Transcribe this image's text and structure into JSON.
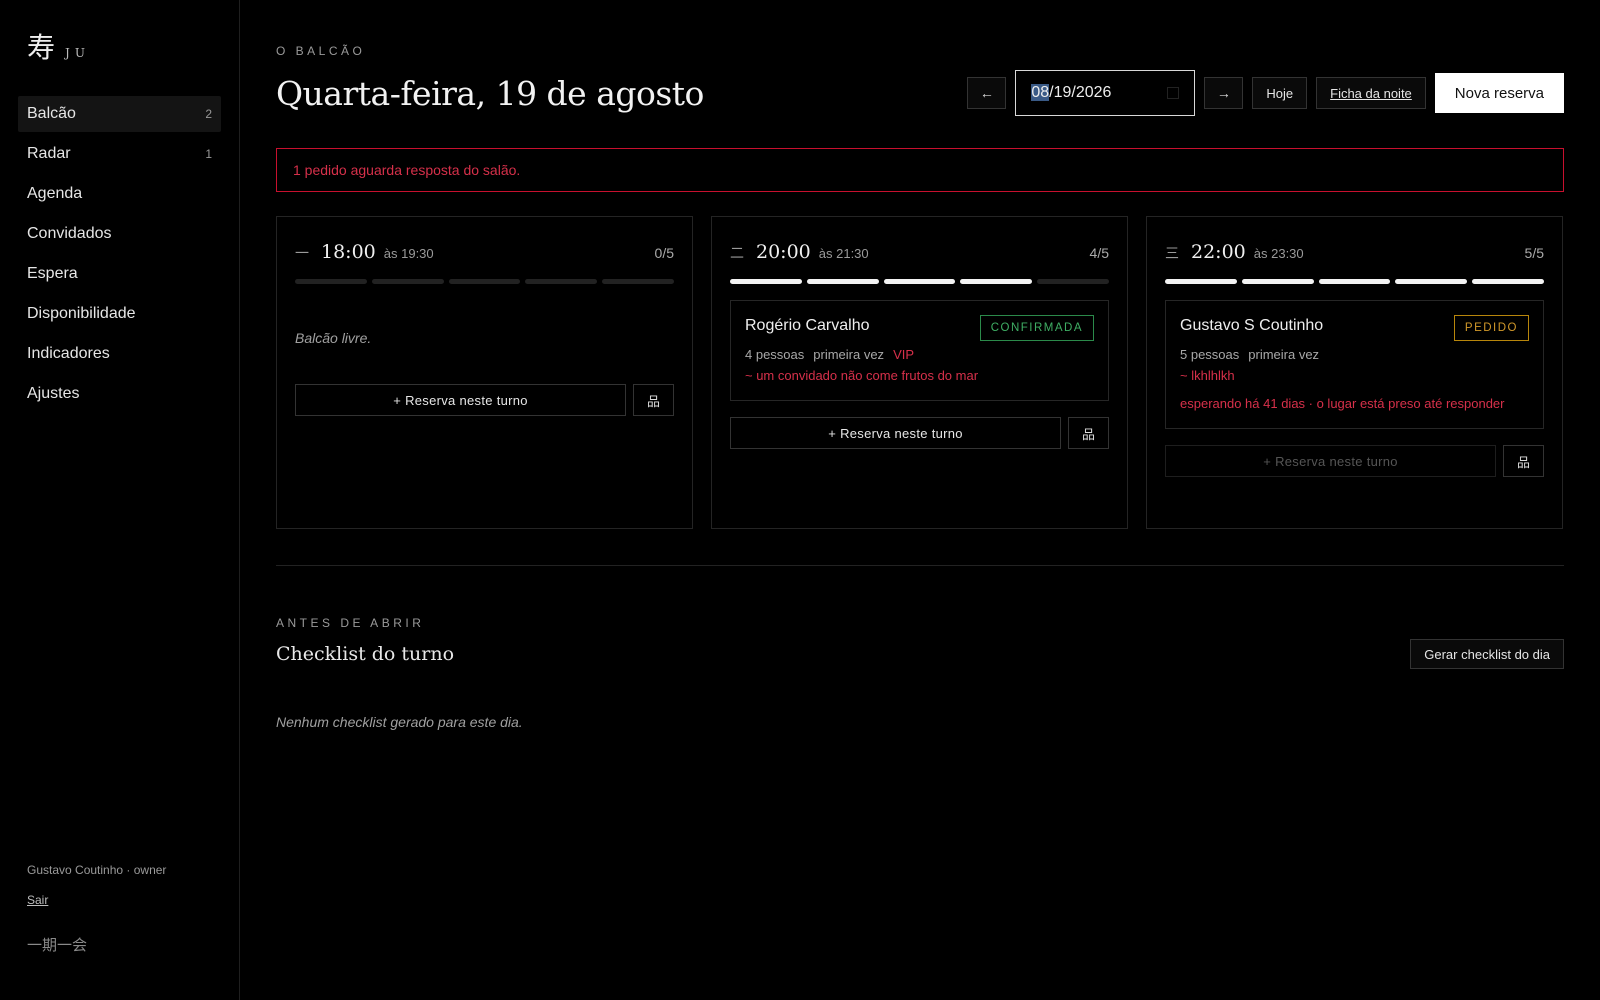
{
  "brand": {
    "glyph": "寿",
    "text": "JU"
  },
  "nav": [
    {
      "label": "Balcão",
      "count": "2",
      "active": true
    },
    {
      "label": "Radar",
      "count": "1"
    },
    {
      "label": "Agenda",
      "count": ""
    },
    {
      "label": "Convidados",
      "count": ""
    },
    {
      "label": "Espera",
      "count": ""
    },
    {
      "label": "Disponibilidade",
      "count": ""
    },
    {
      "label": "Indicadores",
      "count": ""
    },
    {
      "label": "Ajustes",
      "count": ""
    }
  ],
  "sidebar_footer": {
    "user": "Gustavo Coutinho · owner",
    "logout": "Sair",
    "motto": "一期一会"
  },
  "header": {
    "overline": "O BALCÃO",
    "title": "Quarta-feira, 19 de agosto",
    "prev_icon": "←",
    "next_icon": "→",
    "date_month": "08",
    "date_rest": "/19/2026",
    "today": "Hoje",
    "night_sheet": "Ficha da noite",
    "new_reservation": "Nova reserva"
  },
  "alert": {
    "text": "1 pedido aguarda resposta do salão."
  },
  "shifts": [
    {
      "num": "一",
      "time": "18:00",
      "until": "às 19:30",
      "capacity": "0/5",
      "filled": 0,
      "total": 5,
      "empty_text": "Balcão livre.",
      "action": "+ Reserva neste turno",
      "action_icon": "品"
    },
    {
      "num": "二",
      "time": "20:00",
      "until": "às 21:30",
      "capacity": "4/5",
      "filled": 4,
      "total": 5,
      "reservation": {
        "name": "Rogério Carvalho",
        "status": "CONFIRMADA",
        "people": "4 pessoas",
        "visit": "primeira vez",
        "tag": "VIP",
        "note": "~ um convidado não come frutos do mar"
      },
      "action": "+ Reserva neste turno",
      "action_icon": "品"
    },
    {
      "num": "三",
      "time": "22:00",
      "until": "às 23:30",
      "capacity": "5/5",
      "filled": 5,
      "total": 5,
      "reservation": {
        "name": "Gustavo S Coutinho",
        "status": "PEDIDO",
        "people": "5 pessoas",
        "visit": "primeira vez",
        "note": "~ lkhlhlkh",
        "waiting": "esperando há 41 dias · o lugar está preso até responder"
      },
      "action": "+ Reserva neste turno",
      "action_icon": "品"
    }
  ],
  "checklist": {
    "overline": "ANTES DE ABRIR",
    "title": "Checklist do turno",
    "generate": "Gerar checklist do dia",
    "empty": "Nenhum checklist gerado para este dia."
  },
  "colors": {
    "alert": "#c8102e",
    "confirmed": "#2b8a4a",
    "pending": "#b8860b"
  }
}
